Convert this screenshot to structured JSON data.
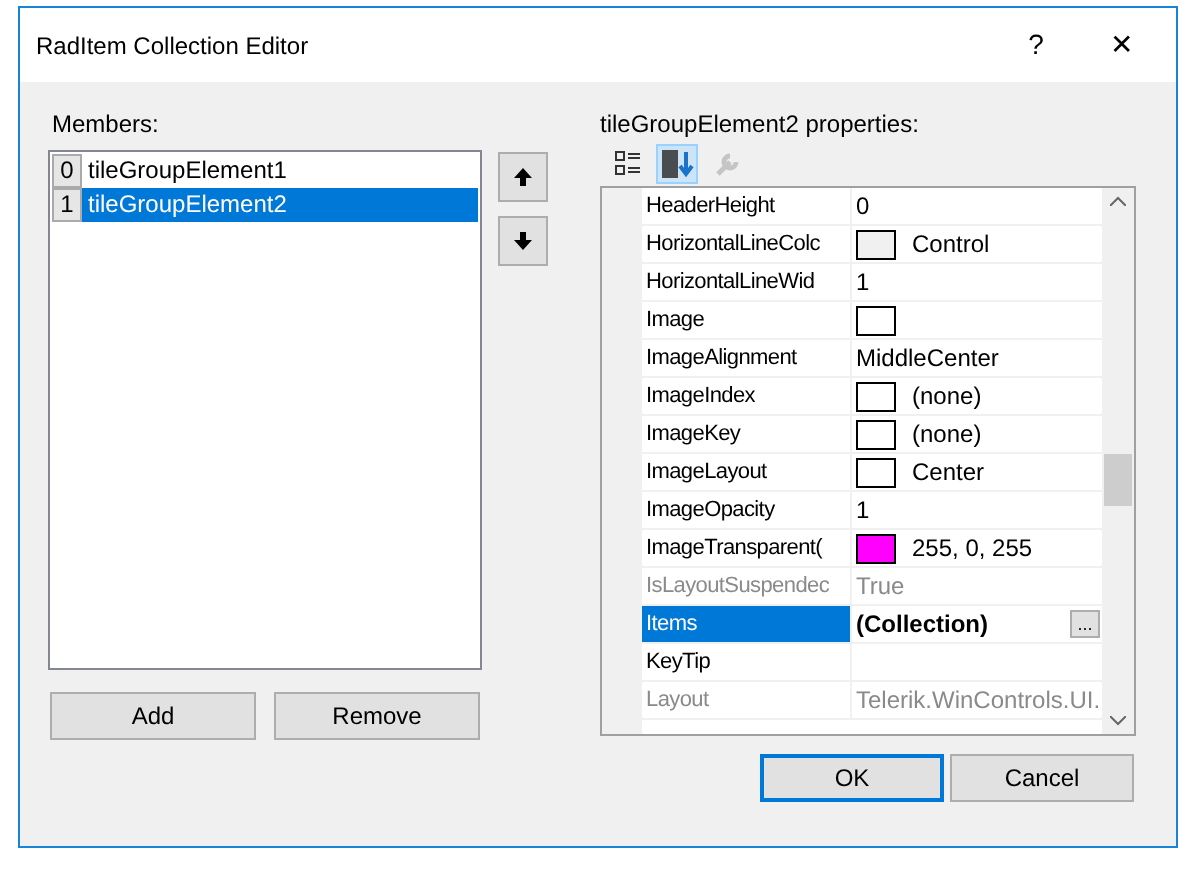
{
  "window": {
    "title": "RadItem Collection Editor",
    "help": "?",
    "close": "✕"
  },
  "members": {
    "label": "Members:",
    "items": [
      {
        "index": "0",
        "name": "tileGroupElement1",
        "selected": false
      },
      {
        "index": "1",
        "name": "tileGroupElement2",
        "selected": true
      }
    ]
  },
  "buttons_left": [
    "Add",
    "Remove"
  ],
  "properties": {
    "label": "tileGroupElement2 properties:",
    "toolbar": [
      {
        "kind": "categorized",
        "selected": false,
        "disabled": false
      },
      {
        "kind": "alphabetical",
        "selected": true,
        "disabled": false
      },
      {
        "kind": "wrench",
        "selected": false,
        "disabled": true
      }
    ],
    "rows": [
      {
        "name": "HeaderHeight",
        "value": "0",
        "kind": "text",
        "disabled": false,
        "selected": false
      },
      {
        "name": "HorizontalLineColc",
        "value": "Control",
        "kind": "color",
        "color": "#f0f0f0",
        "disabled": false,
        "selected": false
      },
      {
        "name": "HorizontalLineWid",
        "value": "1",
        "kind": "text",
        "disabled": false,
        "selected": false
      },
      {
        "name": "Image",
        "value": "",
        "kind": "color",
        "color": "#ffffff",
        "disabled": false,
        "selected": false
      },
      {
        "name": "ImageAlignment",
        "value": "MiddleCenter",
        "kind": "text",
        "disabled": false,
        "selected": false
      },
      {
        "name": "ImageIndex",
        "value": "(none)",
        "kind": "color",
        "color": "#ffffff",
        "disabled": false,
        "selected": false
      },
      {
        "name": "ImageKey",
        "value": "(none)",
        "kind": "color",
        "color": "#ffffff",
        "disabled": false,
        "selected": false
      },
      {
        "name": "ImageLayout",
        "value": "Center",
        "kind": "color",
        "color": "#ffffff",
        "disabled": false,
        "selected": false
      },
      {
        "name": "ImageOpacity",
        "value": "1",
        "kind": "text",
        "disabled": false,
        "selected": false
      },
      {
        "name": "ImageTransparent(",
        "value": "255, 0, 255",
        "kind": "color",
        "color": "#ff00ff",
        "disabled": false,
        "selected": false
      },
      {
        "name": "IsLayoutSuspendec",
        "value": "True",
        "kind": "text",
        "disabled": true,
        "selected": false
      },
      {
        "name": "Items",
        "value": "(Collection)",
        "kind": "collection",
        "button": "...",
        "disabled": false,
        "selected": true
      },
      {
        "name": "KeyTip",
        "value": "",
        "kind": "text",
        "disabled": false,
        "selected": false
      },
      {
        "name": "Layout",
        "value": "Telerik.WinControls.UI.",
        "kind": "text",
        "disabled": true,
        "selected": false
      }
    ]
  },
  "buttons_right": [
    "OK",
    "Cancel"
  ]
}
